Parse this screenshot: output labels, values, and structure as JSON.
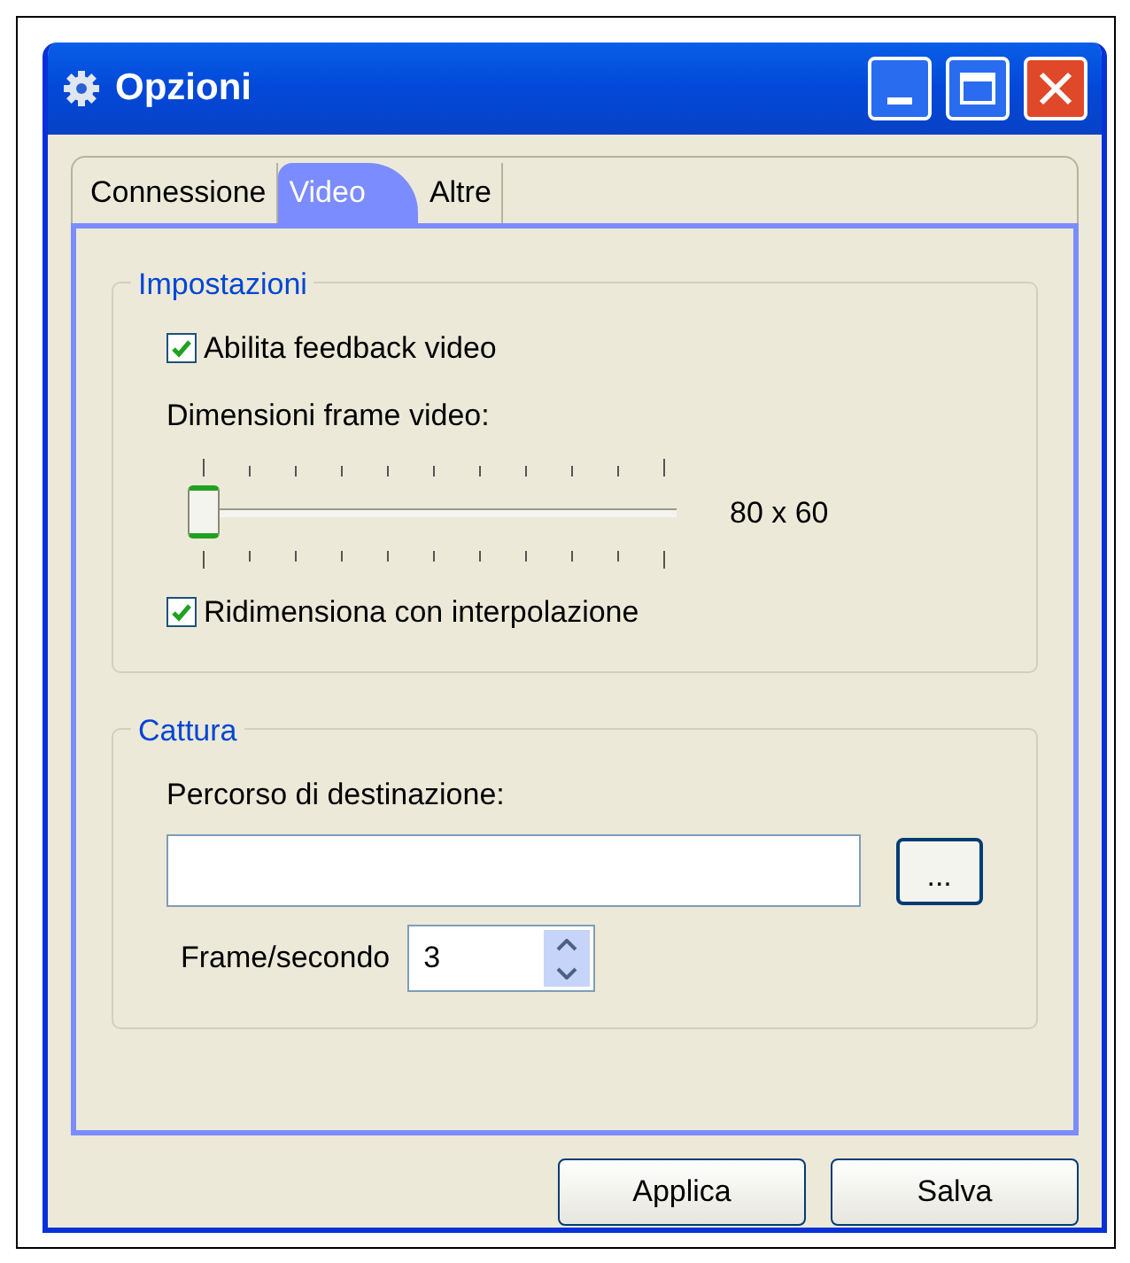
{
  "window": {
    "title": "Opzioni"
  },
  "tabs": [
    {
      "label": "Connessione",
      "selected": false
    },
    {
      "label": "Video",
      "selected": true
    },
    {
      "label": "Altre",
      "selected": false
    }
  ],
  "settings": {
    "title": "Impostazioni",
    "feedback": {
      "label": "Abilita feedback video",
      "checked": true
    },
    "frame_size": {
      "label": "Dimensioni frame video:",
      "level": 0,
      "reading": "80 x 60"
    },
    "interpolation": {
      "label": "Ridimensiona con interpolazione",
      "checked": true
    }
  },
  "capture": {
    "title": "Cattura",
    "path_label": "Percorso di destinazione:",
    "browse": "...",
    "fps_label": "Frame/secondo",
    "fps_value": "3"
  },
  "buttons": [
    "Applica",
    "Salva"
  ]
}
